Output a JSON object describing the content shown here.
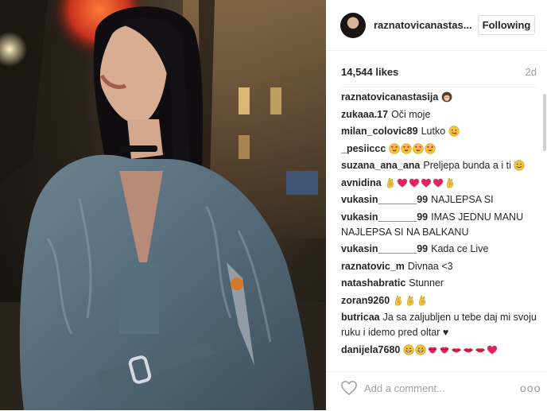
{
  "header": {
    "username": "raznatovicanastas...",
    "follow_label": "Following"
  },
  "stats": {
    "likes": "14,544 likes",
    "age": "2d"
  },
  "comments": [
    {
      "user": "raznatovicanastasija",
      "text": "",
      "emoji": [
        "woman"
      ]
    },
    {
      "user": "zukaaa.17",
      "text": "Oči moje",
      "emoji": []
    },
    {
      "user": "milan_colovic89",
      "text": "Lutko",
      "emoji": [
        "yum"
      ]
    },
    {
      "user": "_pesiiccc",
      "text": "",
      "emoji": [
        "heart-eyes",
        "heart-eyes",
        "heart-eyes",
        "heart-eyes"
      ]
    },
    {
      "user": "suzana_ana_ana",
      "text": "Preljepa bunda a i ti",
      "emoji": [
        "smile"
      ]
    },
    {
      "user": "avnidina",
      "text": "",
      "emoji": [
        "ok-hand",
        "heart",
        "heart",
        "heart",
        "heart",
        "ok-hand"
      ]
    },
    {
      "user": "vukasin_______99",
      "text": "NAJLEPSA SI",
      "emoji": []
    },
    {
      "user": "vukasin_______99",
      "text": "IMAS JEDNU MANU NAJLEPSA SI NA BALKANU",
      "emoji": []
    },
    {
      "user": "vukasin_______99",
      "text": "Kada ce Live",
      "emoji": []
    },
    {
      "user": "raznatovic_m",
      "text": "Divnaa <3",
      "emoji": []
    },
    {
      "user": "natashabratic",
      "text": "Stunner",
      "emoji": []
    },
    {
      "user": "zoran9260",
      "text": "",
      "emoji": [
        "ok-hand",
        "ok-hand",
        "ok-hand"
      ]
    },
    {
      "user": "butricaa",
      "text": "Ja sa zaljubljen u tebe daj mi svoju ruku i idemo pred oltar ♥",
      "emoji": []
    },
    {
      "user": "danijela7680",
      "text": "",
      "emoji": [
        "grin",
        "grin",
        "kiss",
        "kiss",
        "lips",
        "lips",
        "lips",
        "heart"
      ]
    }
  ],
  "footer": {
    "placeholder": "Add a comment...",
    "more": "ooo"
  },
  "colors": {
    "text": "#262626",
    "muted": "#999999",
    "emoji_yellow": "#f5c33b",
    "emoji_red": "#e0245e"
  }
}
